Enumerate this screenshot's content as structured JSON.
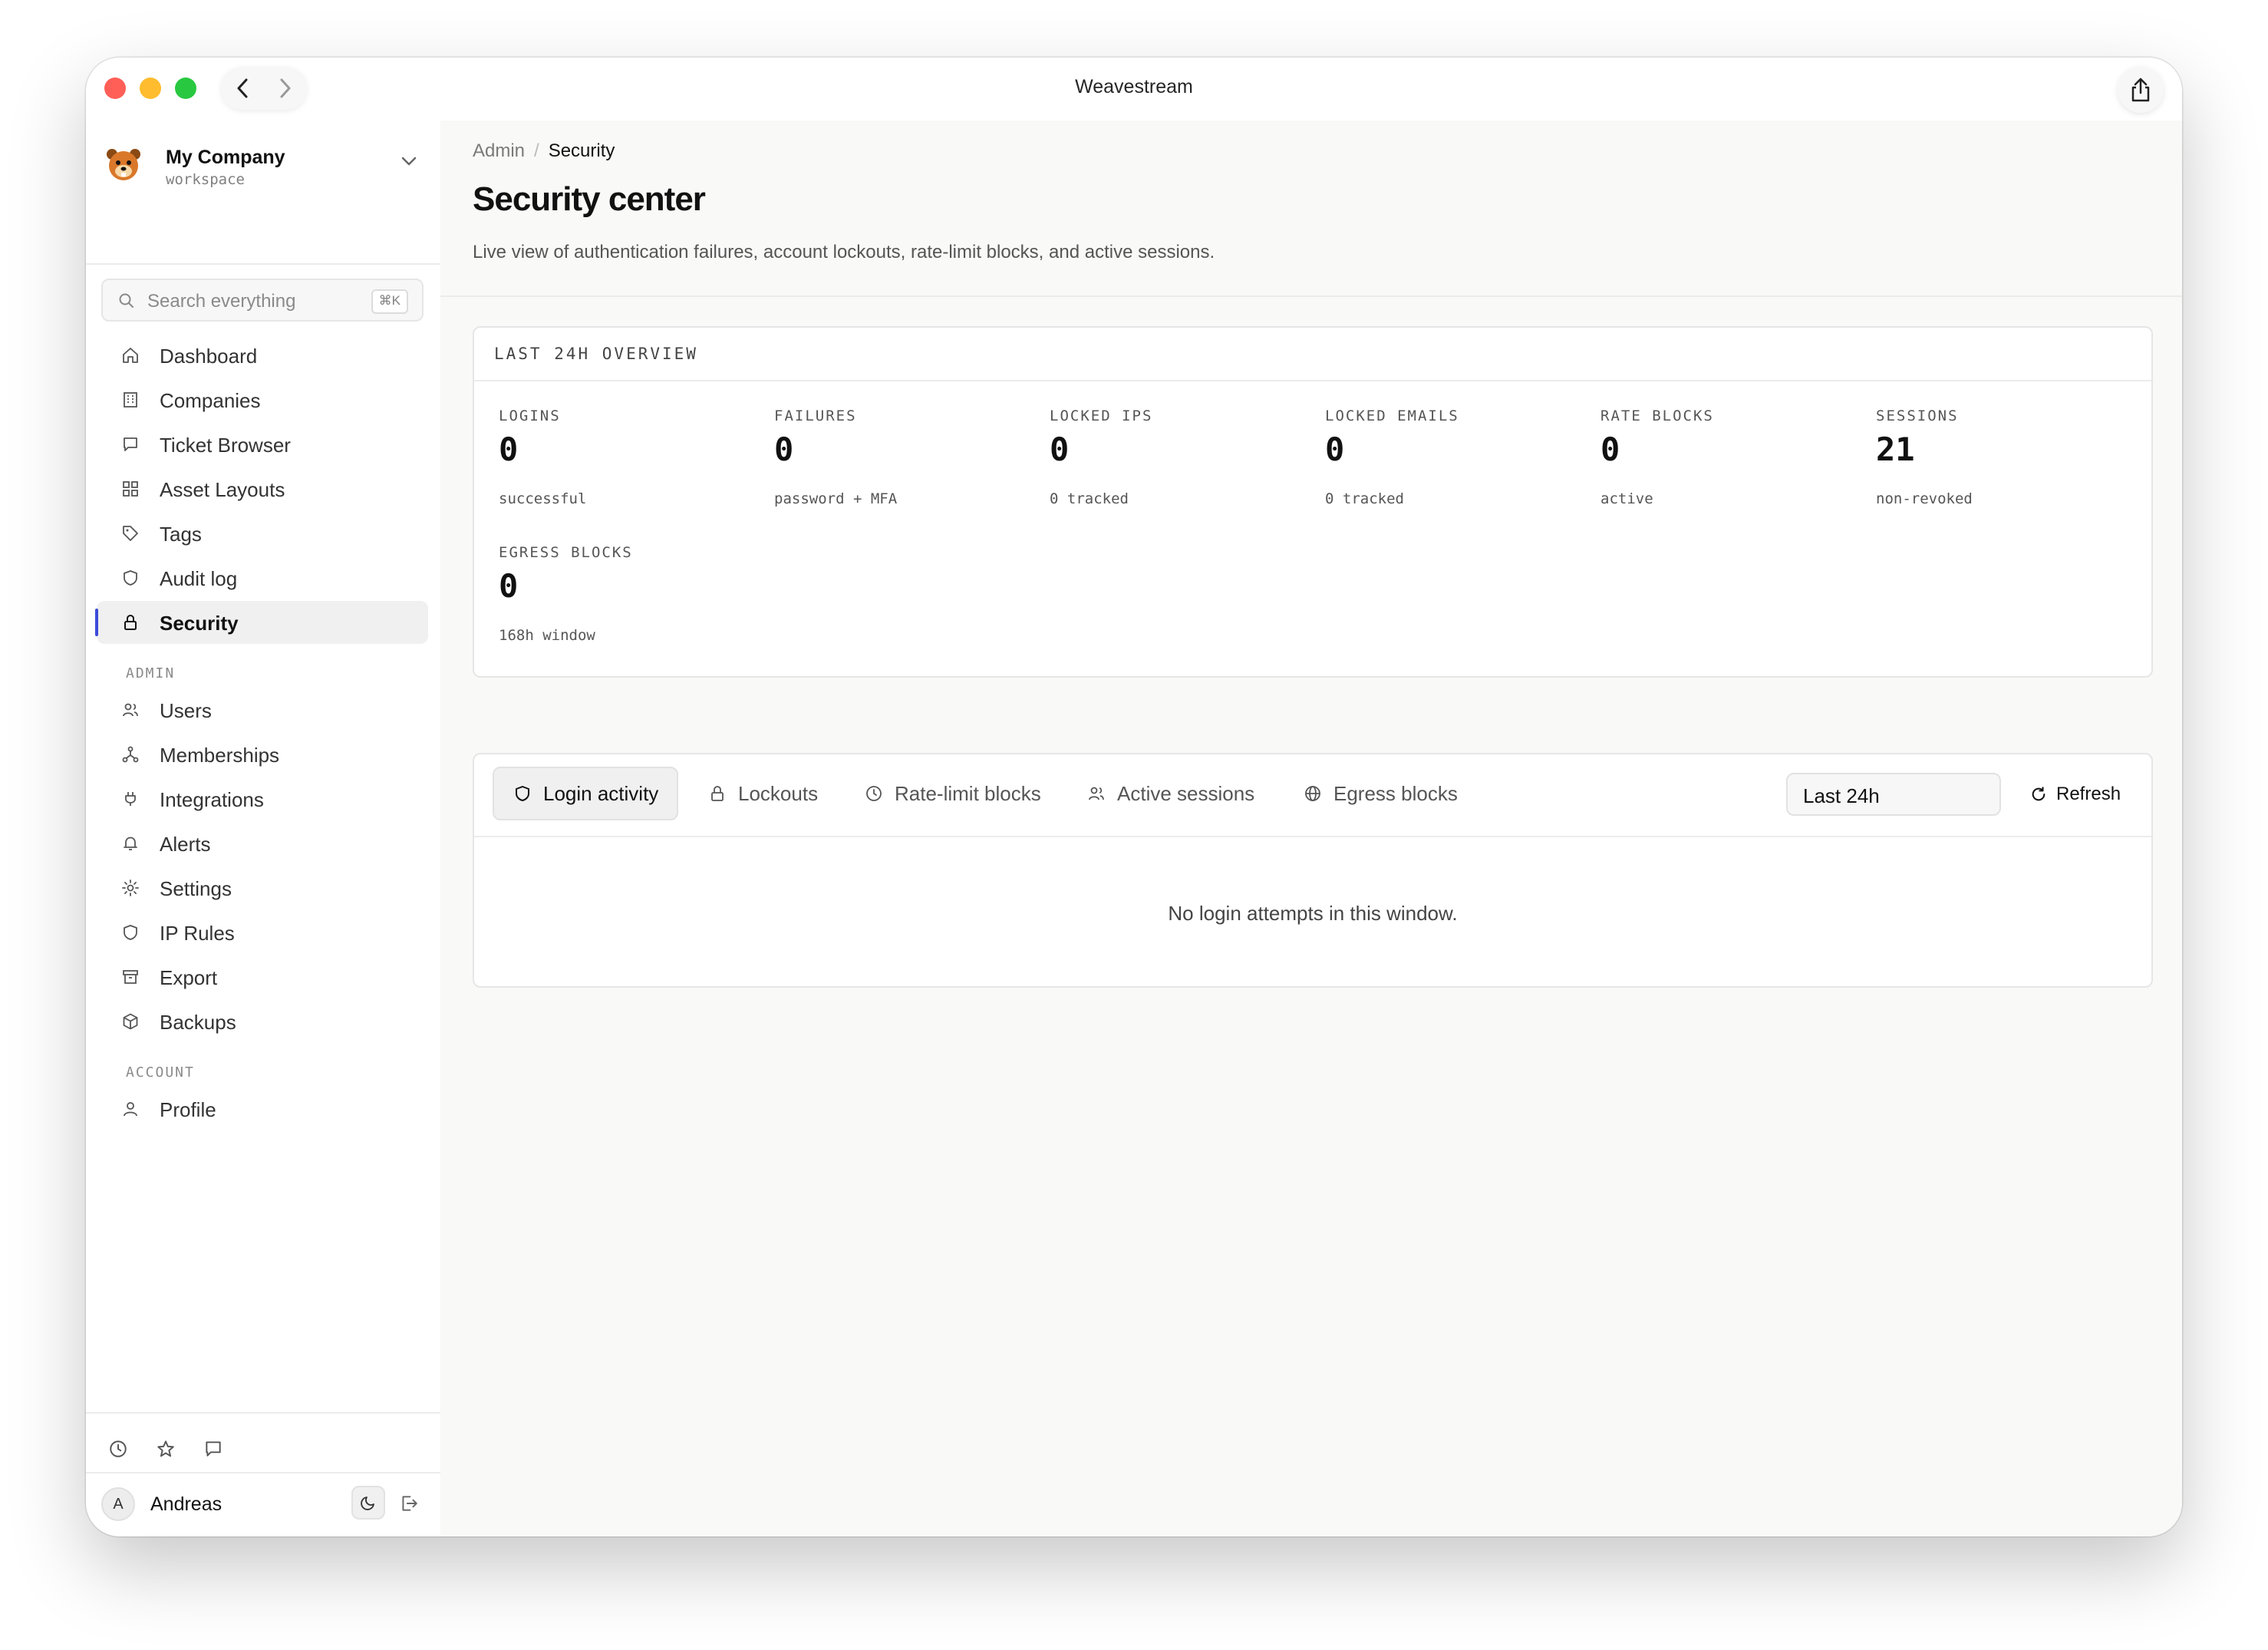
{
  "window": {
    "title": "Weavestream"
  },
  "workspace": {
    "name": "My Company",
    "subtitle": "workspace"
  },
  "search": {
    "placeholder": "Search everything",
    "shortcut": "⌘K"
  },
  "nav": {
    "main": [
      "Dashboard",
      "Companies",
      "Ticket Browser",
      "Asset Layouts",
      "Tags",
      "Audit log",
      "Security"
    ],
    "admin_heading": "ADMIN",
    "admin": [
      "Users",
      "Memberships",
      "Integrations",
      "Alerts",
      "Settings",
      "IP Rules",
      "Export",
      "Backups"
    ],
    "account_heading": "ACCOUNT",
    "account": [
      "Profile"
    ],
    "active": "Security"
  },
  "user": {
    "initial": "A",
    "name": "Andreas"
  },
  "breadcrumb": {
    "parent": "Admin",
    "separator": "/",
    "current": "Security"
  },
  "page": {
    "title": "Security center",
    "description": "Live view of authentication failures, account lockouts, rate-limit blocks, and active sessions."
  },
  "overview": {
    "heading": "LAST 24H OVERVIEW",
    "stats": [
      {
        "label": "LOGINS",
        "value": "0",
        "sub": "successful"
      },
      {
        "label": "FAILURES",
        "value": "0",
        "sub": "password + MFA"
      },
      {
        "label": "LOCKED IPS",
        "value": "0",
        "sub": "0 tracked"
      },
      {
        "label": "LOCKED EMAILS",
        "value": "0",
        "sub": "0 tracked"
      },
      {
        "label": "RATE BLOCKS",
        "value": "0",
        "sub": "active"
      },
      {
        "label": "SESSIONS",
        "value": "21",
        "sub": "non-revoked"
      },
      {
        "label": "EGRESS BLOCKS",
        "value": "0",
        "sub": "168h window"
      }
    ]
  },
  "tabs": [
    {
      "label": "Login activity",
      "icon": "shield-icon"
    },
    {
      "label": "Lockouts",
      "icon": "lock-icon"
    },
    {
      "label": "Rate-limit blocks",
      "icon": "clock-icon"
    },
    {
      "label": "Active sessions",
      "icon": "users-icon"
    },
    {
      "label": "Egress blocks",
      "icon": "globe-icon"
    }
  ],
  "active_tab": "Login activity",
  "range": {
    "selected": "Last 24h"
  },
  "refresh_label": "Refresh",
  "empty_message": "No login attempts in this window.",
  "colors": {
    "accent": "#3b4bd8",
    "close": "#ff5f57",
    "minimize": "#febc2e",
    "maximize": "#28c840"
  }
}
